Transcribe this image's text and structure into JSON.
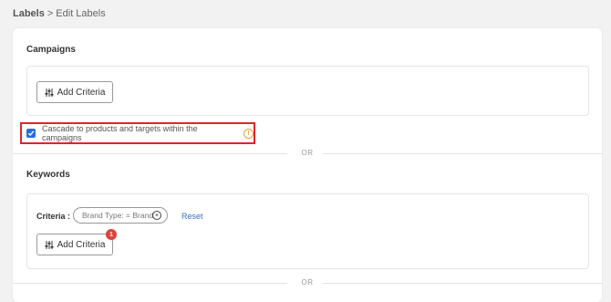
{
  "breadcrumb": {
    "root": "Labels",
    "separator": ">",
    "current": "Edit Labels"
  },
  "campaigns": {
    "title": "Campaigns",
    "add_criteria_label": "Add Criteria"
  },
  "cascade": {
    "label": "Cascade to products and targets within the campaigns",
    "checked": true,
    "info_glyph": "!"
  },
  "or_label": "OR",
  "keywords": {
    "title": "Keywords",
    "criteria_label": "Criteria :",
    "chip_text": "Brand Type: = Brand",
    "chip_close_glyph": "×",
    "reset_label": "Reset",
    "add_criteria_label": "Add Criteria",
    "badge_count": "1"
  },
  "colors": {
    "accent": "#2a6fd6",
    "highlight_border": "#e0252b",
    "badge": "#e0403a",
    "info": "#e6a23c",
    "link": "#3a6fc4"
  }
}
